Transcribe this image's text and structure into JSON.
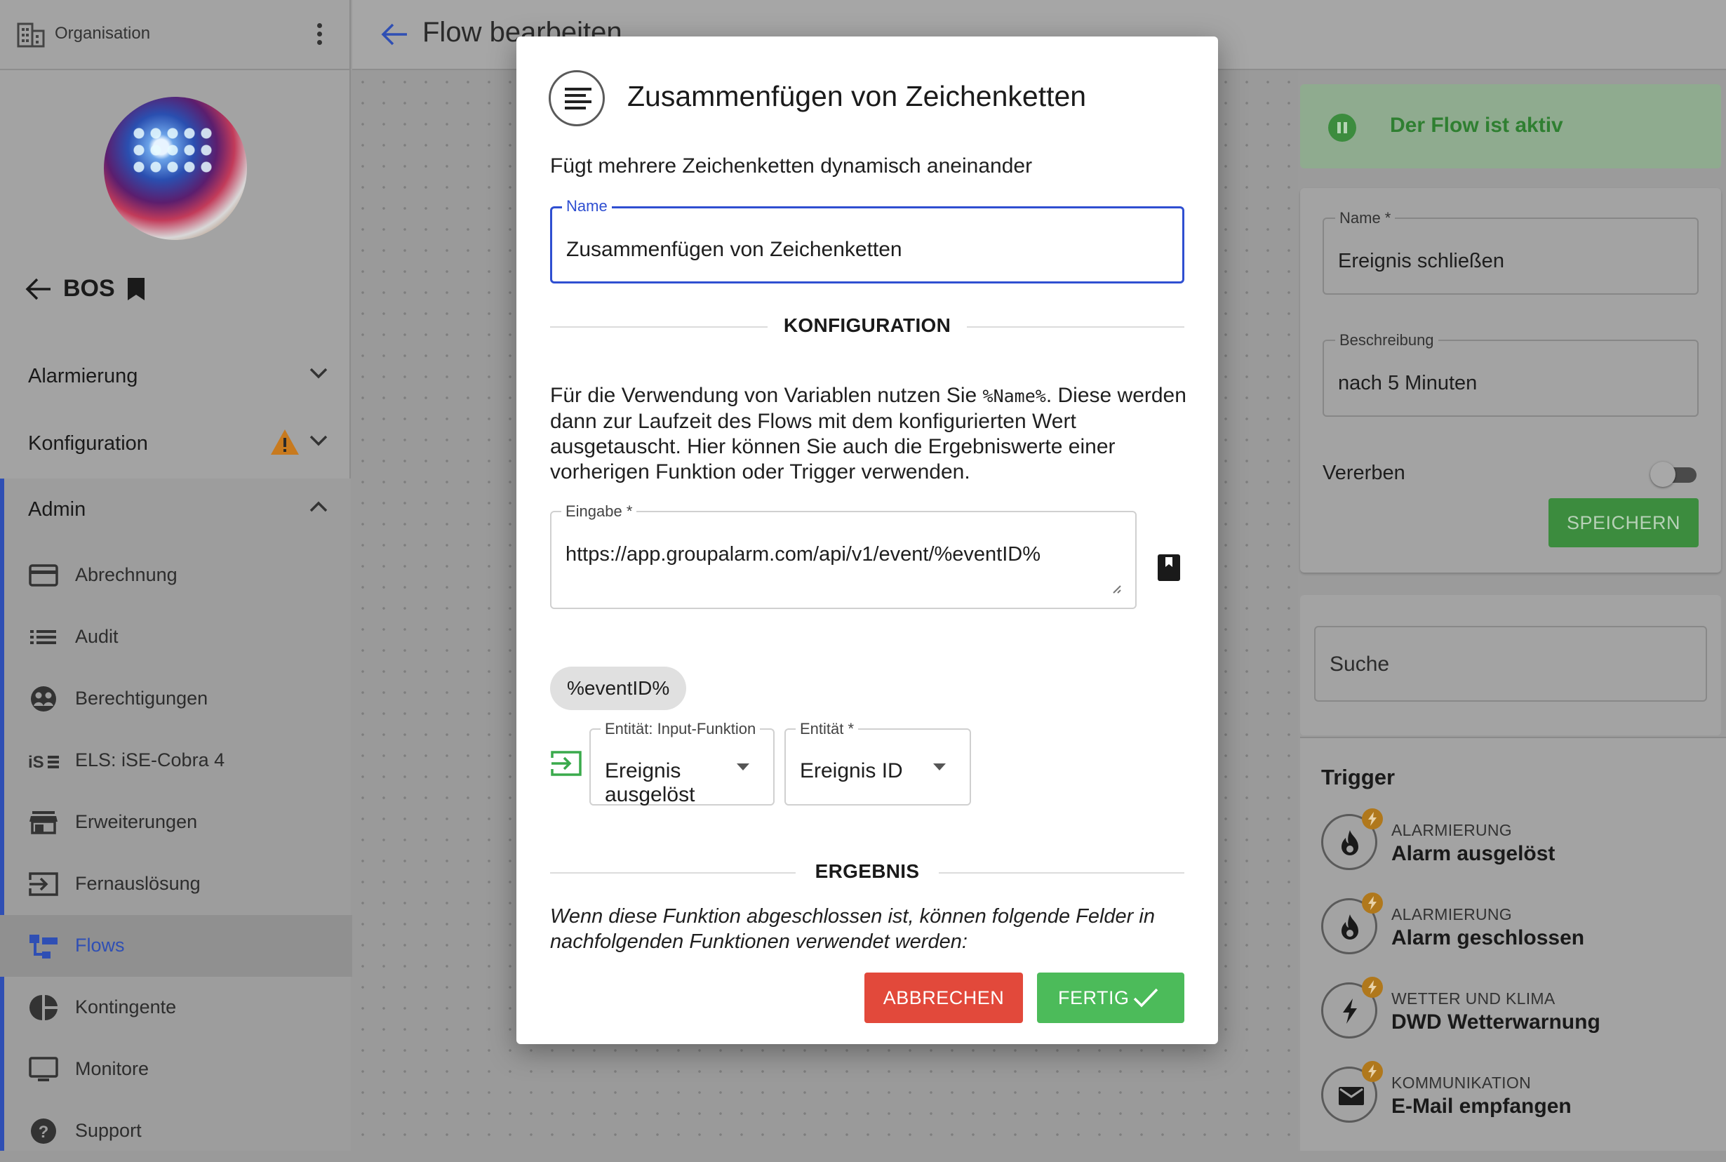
{
  "sidebar": {
    "org_label": "Organisation",
    "back_label": "BOS",
    "sections": {
      "alarmierung": "Alarmierung",
      "konfiguration": "Konfiguration",
      "admin": "Admin"
    },
    "items": [
      {
        "label": "Abrechnung",
        "icon": "credit-card-icon"
      },
      {
        "label": "Audit",
        "icon": "list-icon"
      },
      {
        "label": "Berechtigungen",
        "icon": "people-icon"
      },
      {
        "label": "ELS: iSE-Cobra 4",
        "icon": "ise-icon"
      },
      {
        "label": "Erweiterungen",
        "icon": "store-icon"
      },
      {
        "label": "Fernauslösung",
        "icon": "login-icon"
      },
      {
        "label": "Flows",
        "icon": "flow-icon"
      },
      {
        "label": "Kontingente",
        "icon": "pie-chart-icon"
      },
      {
        "label": "Monitore",
        "icon": "monitor-icon"
      },
      {
        "label": "Support",
        "icon": "help-icon"
      }
    ],
    "active_item": "Flows"
  },
  "header": {
    "title": "Flow bearbeiten"
  },
  "right_panel": {
    "status_text": "Der Flow ist aktiv",
    "name_label": "Name *",
    "name_value": "Ereignis schließen",
    "description_label": "Beschreibung",
    "description_value": "nach 5 Minuten",
    "inherit_label": "Vererben",
    "inherit_on": false,
    "save_label": "SPEICHERN",
    "search_placeholder": "Suche",
    "trigger_title": "Trigger",
    "triggers": [
      {
        "category": "ALARMIERUNG",
        "name": "Alarm ausgelöst",
        "icon": "fire-icon"
      },
      {
        "category": "ALARMIERUNG",
        "name": "Alarm geschlossen",
        "icon": "fire-icon"
      },
      {
        "category": "WETTER UND KLIMA",
        "name": "DWD Wetterwarnung",
        "icon": "lightning-icon"
      },
      {
        "category": "KOMMUNIKATION",
        "name": "E-Mail empfangen",
        "icon": "mail-icon"
      }
    ]
  },
  "modal": {
    "title": "Zusammenfügen von Zeichenketten",
    "description": "Fügt mehrere Zeichenketten dynamisch aneinander",
    "name_label": "Name",
    "name_value": "Zusammenfügen von Zeichenketten",
    "config_heading": "KONFIGURATION",
    "config_text_pre": "Für die Verwendung von Variablen nutzen Sie ",
    "config_code": "%Name%",
    "config_text_post": ". Diese werden dann zur Laufzeit des Flows mit dem konfigurierten Wert ausgetauscht. Hier können Sie auch die Ergebniswerte einer vorherigen Funktion oder Trigger verwenden.",
    "input_label": "Eingabe *",
    "input_value": "https://app.groupalarm.com/api/v1/event/%eventID%",
    "chip_label": "%eventID%",
    "entity_input_label": "Entität: Input-Funktion",
    "entity_input_value": "Ereignis ausgelöst",
    "entity_label": "Entität *",
    "entity_value": "Ereignis ID",
    "result_heading": "ERGEBNIS",
    "result_text": "Wenn diese Funktion abgeschlossen ist, können folgende Felder in nachfolgenden Funktionen verwendet werden:",
    "cancel_label": "ABBRECHEN",
    "done_label": "FERTIG"
  },
  "colors": {
    "primary": "#2f4fd1",
    "success": "#4cbb5a",
    "danger": "#e2493b",
    "warning": "#c87a1e"
  }
}
